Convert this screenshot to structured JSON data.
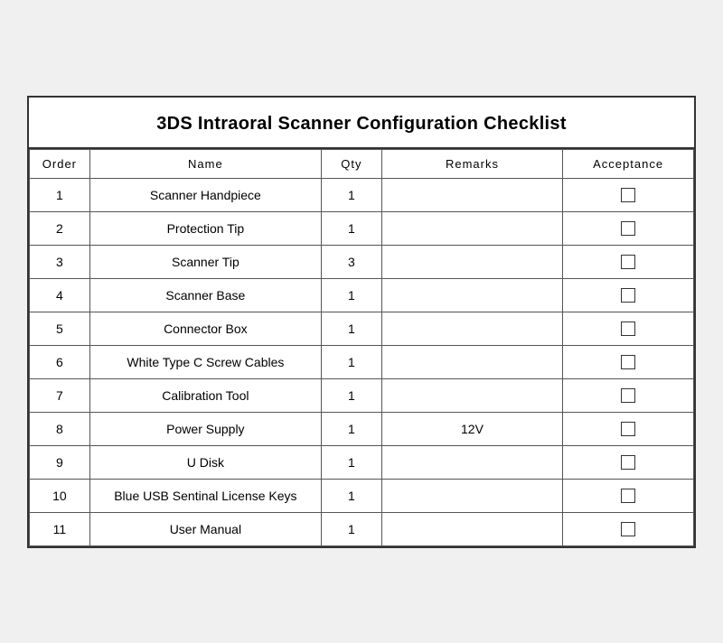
{
  "title": "3DS Intraoral Scanner Configuration Checklist",
  "columns": {
    "order": "Order",
    "name": "Name",
    "qty": "Qty",
    "remarks": "Remarks",
    "acceptance": "Acceptance"
  },
  "rows": [
    {
      "order": "1",
      "name": "Scanner Handpiece",
      "qty": "1",
      "remarks": ""
    },
    {
      "order": "2",
      "name": "Protection Tip",
      "qty": "1",
      "remarks": ""
    },
    {
      "order": "3",
      "name": "Scanner Tip",
      "qty": "3",
      "remarks": ""
    },
    {
      "order": "4",
      "name": "Scanner Base",
      "qty": "1",
      "remarks": ""
    },
    {
      "order": "5",
      "name": "Connector Box",
      "qty": "1",
      "remarks": ""
    },
    {
      "order": "6",
      "name": "White Type C Screw Cables",
      "qty": "1",
      "remarks": ""
    },
    {
      "order": "7",
      "name": "Calibration Tool",
      "qty": "1",
      "remarks": ""
    },
    {
      "order": "8",
      "name": "Power Supply",
      "qty": "1",
      "remarks": "12V"
    },
    {
      "order": "9",
      "name": "U Disk",
      "qty": "1",
      "remarks": ""
    },
    {
      "order": "10",
      "name": "Blue USB Sentinal License Keys",
      "qty": "1",
      "remarks": ""
    },
    {
      "order": "11",
      "name": "User Manual",
      "qty": "1",
      "remarks": ""
    }
  ]
}
